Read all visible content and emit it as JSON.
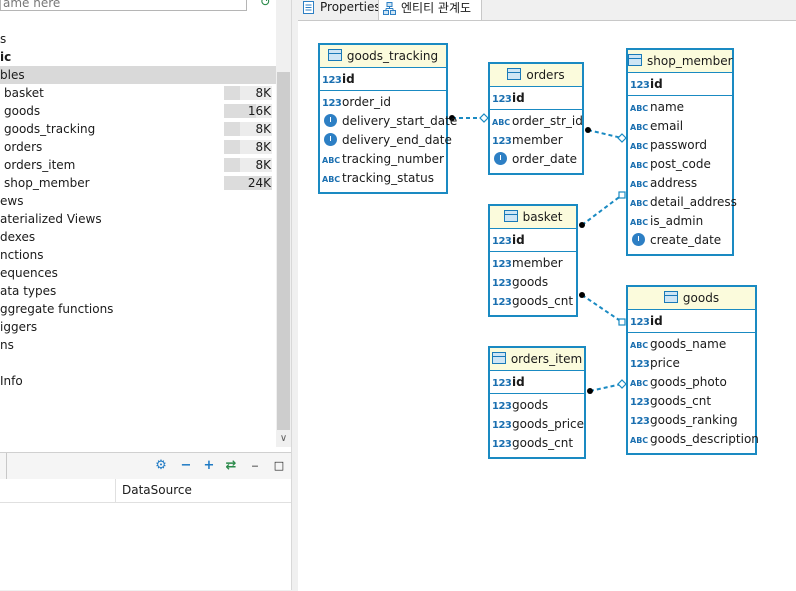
{
  "navigator": {
    "filter_placeholder": "ame here",
    "tree": [
      {
        "label": "s",
        "indent": 0
      },
      {
        "label": "ic",
        "indent": 0,
        "bold": true
      },
      {
        "label": "bles",
        "indent": 0,
        "selected": true
      },
      {
        "label": "basket",
        "indent": 4,
        "size": "8K",
        "fill": 0.33
      },
      {
        "label": "goods",
        "indent": 4,
        "size": "16K",
        "fill": 0.67
      },
      {
        "label": "goods_tracking",
        "indent": 4,
        "size": "8K",
        "fill": 0.33
      },
      {
        "label": "orders",
        "indent": 4,
        "size": "8K",
        "fill": 0.33
      },
      {
        "label": "orders_item",
        "indent": 4,
        "size": "8K",
        "fill": 0.33
      },
      {
        "label": "shop_member",
        "indent": 4,
        "size": "24K",
        "fill": 1.0
      },
      {
        "label": "ews",
        "indent": 0
      },
      {
        "label": "aterialized Views",
        "indent": 0
      },
      {
        "label": "dexes",
        "indent": 0
      },
      {
        "label": "nctions",
        "indent": 0
      },
      {
        "label": "equences",
        "indent": 0
      },
      {
        "label": "ata types",
        "indent": 0
      },
      {
        "label": "ggregate functions",
        "indent": 0
      },
      {
        "label": "iggers",
        "indent": 0
      },
      {
        "label": "ns",
        "indent": 0
      },
      {
        "label": "",
        "indent": 0
      },
      {
        "label": "Info",
        "indent": 0
      }
    ]
  },
  "bottom_panel": {
    "column_header": "DataSource",
    "toolbar_icons": [
      "gear-icon",
      "minus-icon",
      "plus-icon",
      "swap-icon",
      "minimize-icon",
      "maximize-icon"
    ]
  },
  "tabs": [
    {
      "label": "Properties",
      "icon": "properties-icon"
    },
    {
      "label": "엔티티 관계도",
      "icon": "er-diagram-icon",
      "active": true
    }
  ],
  "entities": {
    "goods_tracking": {
      "title": "goods_tracking",
      "pk": "id",
      "columns": [
        {
          "name": "order_id",
          "type": "123"
        },
        {
          "name": "delivery_start_date",
          "type": "clock"
        },
        {
          "name": "delivery_end_date",
          "type": "clock"
        },
        {
          "name": "tracking_number",
          "type": "ABC"
        },
        {
          "name": "tracking_status",
          "type": "ABC"
        }
      ]
    },
    "orders": {
      "title": "orders",
      "pk": "id",
      "columns": [
        {
          "name": "order_str_id",
          "type": "ABC"
        },
        {
          "name": "member",
          "type": "123"
        },
        {
          "name": "order_date",
          "type": "clock"
        }
      ]
    },
    "shop_member": {
      "title": "shop_member",
      "pk": "id",
      "columns": [
        {
          "name": "name",
          "type": "ABC"
        },
        {
          "name": "email",
          "type": "ABC"
        },
        {
          "name": "password",
          "type": "ABC"
        },
        {
          "name": "post_code",
          "type": "ABC"
        },
        {
          "name": "address",
          "type": "ABC"
        },
        {
          "name": "detail_address",
          "type": "ABC"
        },
        {
          "name": "is_admin",
          "type": "ABC"
        },
        {
          "name": "create_date",
          "type": "clock"
        }
      ]
    },
    "basket": {
      "title": "basket",
      "pk": "id",
      "columns": [
        {
          "name": "member",
          "type": "123"
        },
        {
          "name": "goods",
          "type": "123"
        },
        {
          "name": "goods_cnt",
          "type": "123"
        }
      ]
    },
    "goods": {
      "title": "goods",
      "pk": "id",
      "columns": [
        {
          "name": "goods_name",
          "type": "ABC"
        },
        {
          "name": "price",
          "type": "123"
        },
        {
          "name": "goods_photo",
          "type": "ABC"
        },
        {
          "name": "goods_cnt",
          "type": "123"
        },
        {
          "name": "goods_ranking",
          "type": "123"
        },
        {
          "name": "goods_description",
          "type": "ABC"
        }
      ]
    },
    "orders_item": {
      "title": "orders_item",
      "pk": "id",
      "columns": [
        {
          "name": "goods",
          "type": "123"
        },
        {
          "name": "goods_price",
          "type": "123"
        },
        {
          "name": "goods_cnt",
          "type": "123"
        }
      ]
    }
  },
  "pk_type_label": "123",
  "relationships": [
    {
      "from": "goods_tracking",
      "to": "orders"
    },
    {
      "from": "orders",
      "to": "shop_member"
    },
    {
      "from": "basket",
      "to": "shop_member"
    },
    {
      "from": "basket",
      "to": "goods"
    },
    {
      "from": "orders_item",
      "to": "goods"
    }
  ],
  "colors": {
    "entity_border": "#1a8ac2",
    "entity_header": "#fbfbdc",
    "relation_line": "#1a8ac2"
  }
}
